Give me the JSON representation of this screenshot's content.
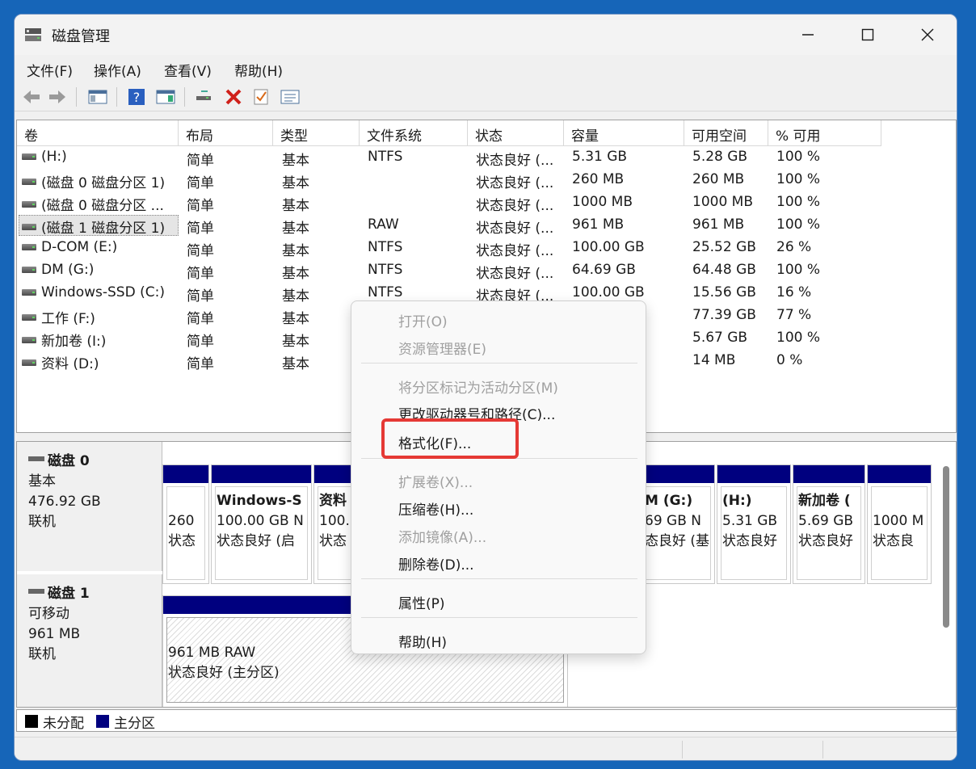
{
  "window": {
    "title": "磁盘管理"
  },
  "menubar": {
    "items": [
      "文件(F)",
      "操作(A)",
      "查看(V)",
      "帮助(H)"
    ]
  },
  "columns": [
    "卷",
    "布局",
    "类型",
    "文件系统",
    "状态",
    "容量",
    "可用空间",
    "% 可用"
  ],
  "volumes": [
    [
      "(H:)",
      "简单",
      "基本",
      "NTFS",
      "状态良好 (...",
      "5.31 GB",
      "5.28 GB",
      "100 %"
    ],
    [
      "(磁盘 0 磁盘分区 1)",
      "简单",
      "基本",
      "",
      "状态良好 (...",
      "260 MB",
      "260 MB",
      "100 %"
    ],
    [
      "(磁盘 0 磁盘分区 ...",
      "简单",
      "基本",
      "",
      "状态良好 (...",
      "1000 MB",
      "1000 MB",
      "100 %"
    ],
    [
      "(磁盘 1 磁盘分区 1)",
      "简单",
      "基本",
      "RAW",
      "状态良好 (...",
      "961 MB",
      "961 MB",
      "100 %"
    ],
    [
      "D-COM (E:)",
      "简单",
      "基本",
      "NTFS",
      "状态良好 (...",
      "100.00 GB",
      "25.52 GB",
      "26 %"
    ],
    [
      "DM (G:)",
      "简单",
      "基本",
      "NTFS",
      "状态良好 (...",
      "64.69 GB",
      "64.48 GB",
      "100 %"
    ],
    [
      "Windows-SSD (C:)",
      "简单",
      "基本",
      "NTFS",
      "状态良好 (...",
      "100.00 GB",
      "15.56 GB",
      "16 %"
    ],
    [
      "工作 (F:)",
      "简单",
      "基本",
      "",
      "",
      "",
      "77.39 GB",
      "77 %"
    ],
    [
      "新加卷 (I:)",
      "简单",
      "基本",
      "",
      "",
      "",
      "5.67 GB",
      "100 %"
    ],
    [
      "资料 (D:)",
      "简单",
      "基本",
      "",
      "",
      "",
      "14 MB",
      "0 %"
    ]
  ],
  "disk0": {
    "name": "磁盘 0",
    "type": "基本",
    "size": "476.92 GB",
    "status": "联机",
    "partitions": [
      {
        "l1": "",
        "l2": "260",
        "l3": "状态"
      },
      {
        "l1": "Windows-S",
        "l2": "100.00 GB N",
        "l3": "状态良好 (启"
      },
      {
        "l1": "资料",
        "l2": "100.",
        "l3": "状态"
      },
      {
        "l1": "M  (G:)",
        "l2": "69 GB N",
        "l3": "态良好 (基"
      },
      {
        "l1": "(H:)",
        "l2": "5.31 GB",
        "l3": "状态良好"
      },
      {
        "l1": "新加卷 (",
        "l2": "5.69 GB",
        "l3": "状态良好"
      },
      {
        "l1": "",
        "l2": "1000 M",
        "l3": "状态良"
      }
    ]
  },
  "disk1": {
    "name": "磁盘 1",
    "type": "可移动",
    "size": "961 MB",
    "status": "联机",
    "partition": {
      "l1": "961 MB RAW",
      "l2": "状态良好 (主分区)"
    }
  },
  "legend": {
    "unallocated": "未分配",
    "primary": "主分区"
  },
  "context_menu": {
    "open": "打开(O)",
    "explorer": "资源管理器(E)",
    "mark_active": "将分区标记为活动分区(M)",
    "change_letter": "更改驱动器号和路径(C)...",
    "format": "格式化(F)...",
    "extend": "扩展卷(X)...",
    "shrink": "压缩卷(H)...",
    "add_mirror": "添加镜像(A)...",
    "delete": "删除卷(D)...",
    "properties": "属性(P)",
    "help": "帮助(H)"
  },
  "colors": {
    "primary_partition": "#00007f",
    "unallocated": "#000000",
    "highlight": "#e53935",
    "background": "#1665b8"
  },
  "icons": [
    "disk-manager-icon",
    "back-arrow-icon",
    "forward-arrow-icon",
    "console-tree-icon",
    "help-icon",
    "action-pane-icon",
    "connect-icon",
    "delete-x-icon",
    "check-icon",
    "properties-icon"
  ]
}
